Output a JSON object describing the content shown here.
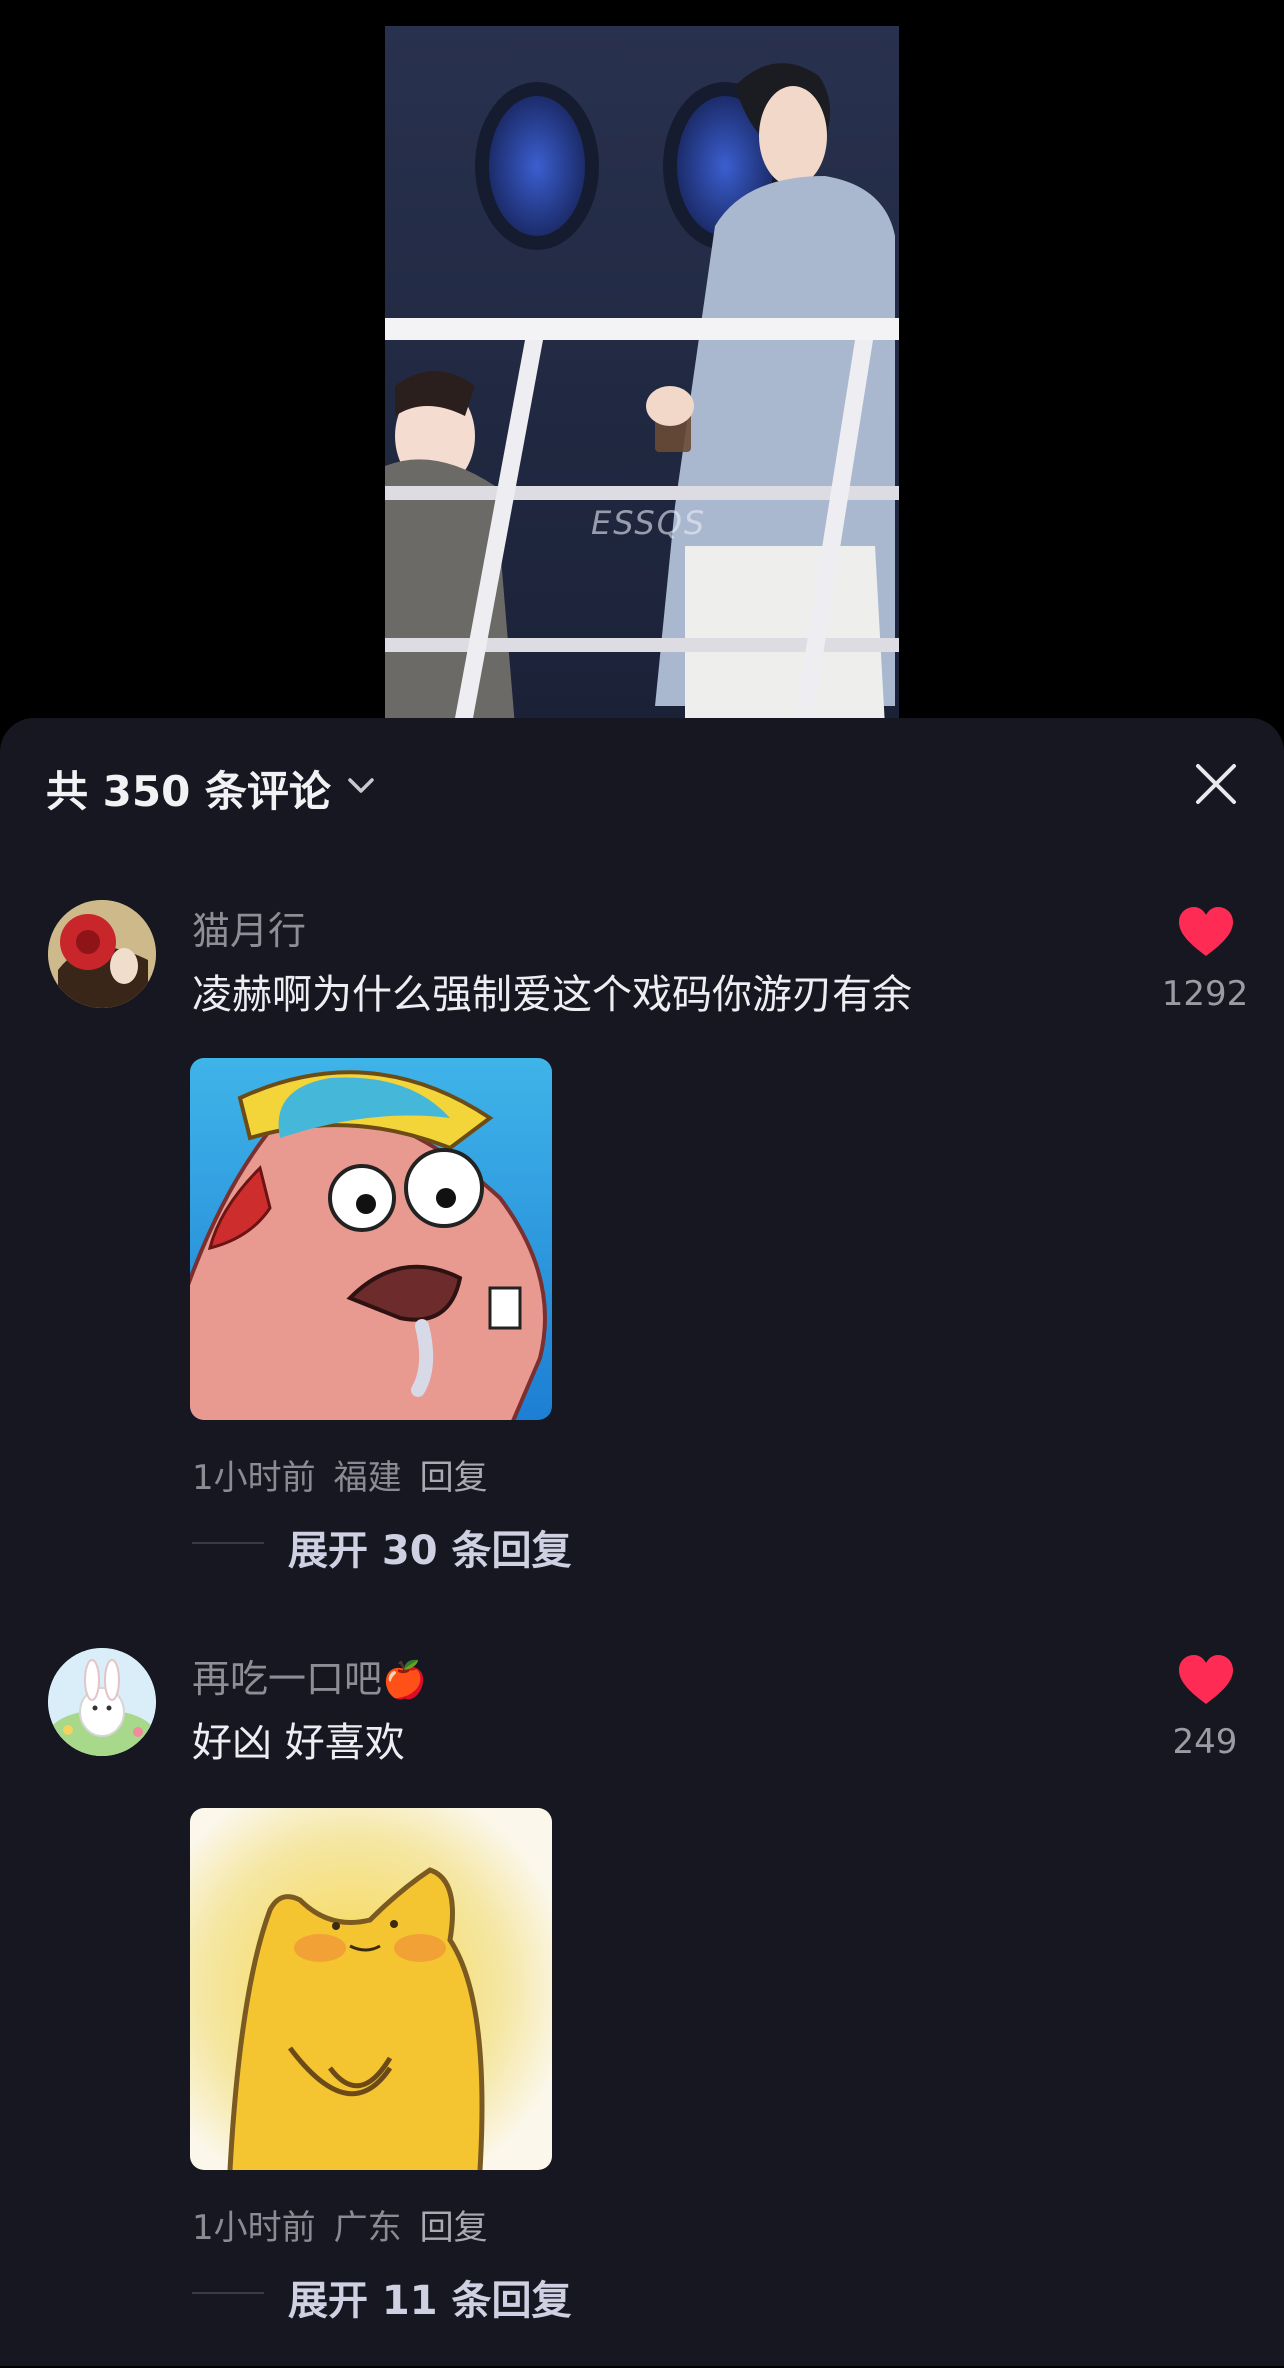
{
  "video": {
    "watermark": "ESSQS"
  },
  "comments_panel": {
    "count_label": "共 350 条评论",
    "accent_like_color": "#fe2c55",
    "comments": [
      {
        "username": "猫月行",
        "text": "凌赫啊为什么强制爱这个戏码你游刃有余",
        "likes": "1292",
        "time": "1小时前",
        "location": "福建",
        "reply_label": "回复",
        "expand_label": "展开 30 条回复",
        "sticker": "cartoon-sticker-drooling"
      },
      {
        "username": "再吃一口吧",
        "username_emoji": "🍎",
        "text": "好凶 好喜欢",
        "likes": "249",
        "time": "1小时前",
        "location": "广东",
        "reply_label": "回复",
        "expand_label": "展开 11 条回复",
        "sticker": "cat-sticker-yellow"
      }
    ]
  }
}
